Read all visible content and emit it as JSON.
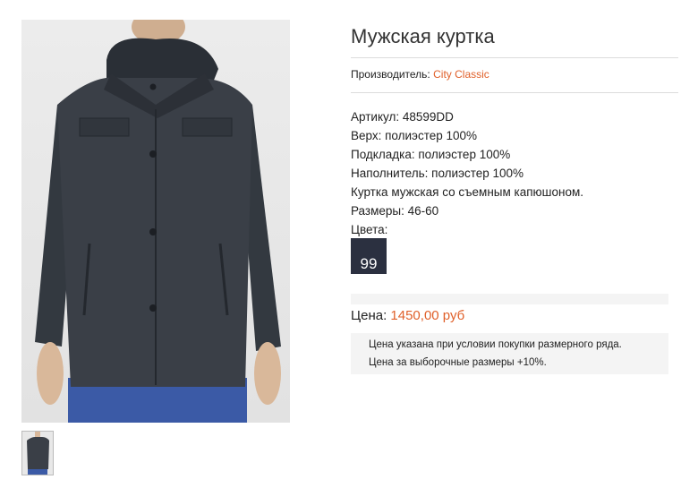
{
  "product": {
    "title": "Мужская куртка",
    "maker_label": "Производитель:",
    "maker_name": "City Classic",
    "specs": [
      "Артикул: 48599DD",
      "Верх: полиэстер 100%",
      "Подкладка: полиэстер 100%",
      "Наполнитель: полиэстер 100%",
      "Куртка мужская со съемным капюшоном.",
      "Размеры: 46-60",
      "Цвета:"
    ],
    "color_swatch": {
      "label": "99",
      "color": "#2b3040"
    },
    "price_label": "Цена:",
    "price_value": "1450,00 руб",
    "notes": [
      "Цена указана при условии покупки размерного ряда.",
      "Цена за выборочные размеры +10%."
    ]
  },
  "colors": {
    "accent": "#e0602a"
  }
}
